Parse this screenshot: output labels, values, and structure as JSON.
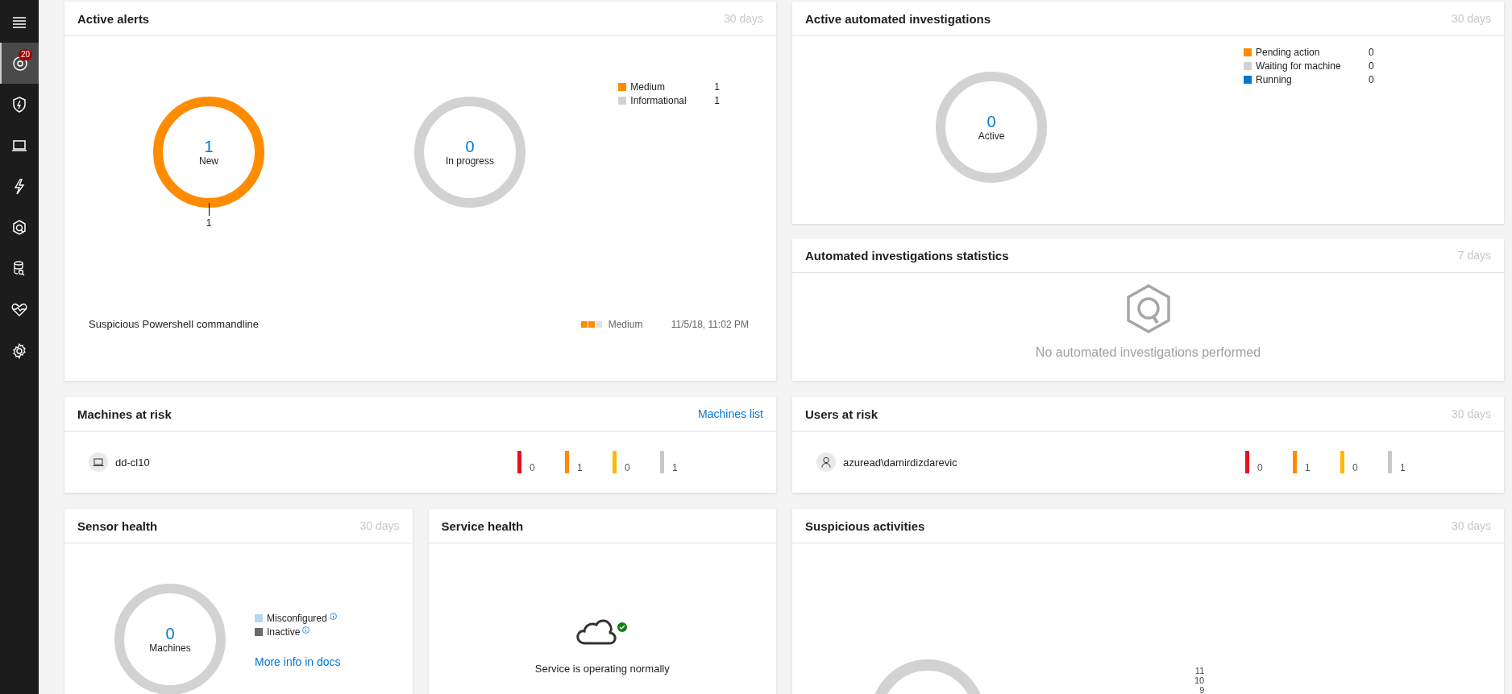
{
  "sidebar": {
    "items": [
      {
        "kind": "menu",
        "selected": false
      },
      {
        "kind": "dashboard",
        "selected": true,
        "badge": "20"
      },
      {
        "kind": "shield",
        "selected": false
      },
      {
        "kind": "laptop",
        "selected": false
      },
      {
        "kind": "bolt",
        "selected": false
      },
      {
        "kind": "investigation",
        "selected": false
      },
      {
        "kind": "database",
        "selected": false
      },
      {
        "kind": "health",
        "selected": false
      },
      {
        "kind": "settings",
        "selected": false
      }
    ]
  },
  "active_alerts": {
    "title": "Active alerts",
    "period": "30 days",
    "donuts": [
      {
        "value": "1",
        "label": "New",
        "color": "#ff8c00",
        "callout": "1"
      },
      {
        "value": "0",
        "label": "In progress",
        "color": "#d2d2d2"
      }
    ],
    "legend": [
      {
        "label": "Medium",
        "count": "1",
        "color": "#ff8c00"
      },
      {
        "label": "Informational",
        "count": "1",
        "color": "#d2d2d2"
      }
    ],
    "alerts": [
      {
        "name": "Suspicious Powershell commandline",
        "level": 0.67,
        "severity": "Medium",
        "time": "11/5/18, 11:02 PM"
      }
    ]
  },
  "active_investigations": {
    "title": "Active automated investigations",
    "period": "30 days",
    "donut": {
      "value": "0",
      "label": "Active",
      "color": "#d2d2d2"
    },
    "legend": [
      {
        "label": "Pending action",
        "count": "0",
        "color": "#ff8c00"
      },
      {
        "label": "Waiting for machine",
        "count": "0",
        "color": "#d2d2d2"
      },
      {
        "label": "Running",
        "count": "0",
        "color": "#0078d4"
      }
    ]
  },
  "investigation_stats": {
    "title": "Automated investigations statistics",
    "period": "7 days",
    "empty_message": "No automated investigations performed"
  },
  "machines_at_risk": {
    "title": "Machines at risk",
    "link": "Machines list",
    "rows": [
      {
        "name": "dd-cl10",
        "counts": [
          {
            "value": "0",
            "color": "#e81123"
          },
          {
            "value": "1",
            "color": "#ff8c00"
          },
          {
            "value": "0",
            "color": "#ffb900"
          },
          {
            "value": "1",
            "color": "#c8c8c8"
          }
        ]
      }
    ]
  },
  "users_at_risk": {
    "title": "Users at risk",
    "period": "30 days",
    "rows": [
      {
        "name": "azuread\\damirdizdarevic",
        "counts": [
          {
            "value": "0",
            "color": "#e81123"
          },
          {
            "value": "1",
            "color": "#ff8c00"
          },
          {
            "value": "0",
            "color": "#ffb900"
          },
          {
            "value": "1",
            "color": "#c8c8c8"
          }
        ]
      }
    ]
  },
  "sensor_health": {
    "title": "Sensor health",
    "period": "30 days",
    "donut": {
      "value": "0",
      "label": "Machines",
      "color": "#d2d2d2"
    },
    "legend": [
      {
        "label": "Misconfigured",
        "color": "#b3d6f2"
      },
      {
        "label": "Inactive",
        "color": "#696969"
      }
    ],
    "link": "More info in docs"
  },
  "service_health": {
    "title": "Service health",
    "status": "Service is operating normally"
  },
  "suspicious_activities": {
    "title": "Suspicious activities",
    "period": "30 days",
    "axis_labels": [
      "11",
      "10",
      "9"
    ]
  }
}
